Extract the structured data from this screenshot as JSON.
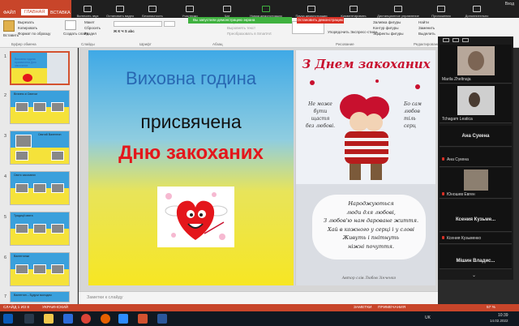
{
  "ribbon": {
    "tabs": [
      "ФАЙЛ",
      "ГЛАВНАЯ",
      "ВСТАВКА"
    ],
    "active_tab": "ГЛАВНАЯ",
    "clipboard": {
      "paste": "Вставить",
      "cut": "Вырезать",
      "copy": "Копировать",
      "format": "Формат по образцу",
      "group": "Буфер обмена"
    },
    "slides": {
      "create": "Создать слайд",
      "layout": "Макет",
      "reset": "Сбросить",
      "section": "Раздел",
      "group": "Слайды"
    },
    "font_group": "Шрифт",
    "paragraph_group": "Абзац",
    "drawing": {
      "arrange": "Упорядочить",
      "quick_styles": "Экспресс-стили",
      "fill": "Заливка фигуры",
      "outline": "Контур фигуры",
      "effects": "Эффекты фигуры",
      "group": "Рисование"
    },
    "editing": {
      "find": "Найти",
      "replace": "Заменить",
      "select": "Выделить",
      "group": "Редактирование"
    },
    "text_direction": "Направление текста",
    "align_text": "Выровнять текст",
    "convert_smartart": "Преобразовать в SmartArt",
    "user": "Вход"
  },
  "zoom": {
    "buttons": [
      "Включить звук",
      "Остановить видео",
      "Безопасность",
      "Участники",
      "Чат",
      "Новая демонстрация",
      "Пауза демонстрации",
      "Комментировать",
      "Дистанционное управление",
      "Приложения",
      "Дополнительно"
    ],
    "participants_count": "52",
    "share_banner": "Вы запустили демонстрацию экрана",
    "stop_share": "Остановить демонстрацию"
  },
  "thumbnails": [
    "1",
    "2",
    "3",
    "4",
    "5",
    "6",
    "7"
  ],
  "thumb_texts": {
    "t1_title": "Виховна година присвячена Дню закоханих",
    "t2_title": "Вітання зі Святом",
    "t3_title": "Святий Валентин",
    "t4_title": "Свято закоханих",
    "t5_title": "Традиції свята",
    "t6_title": "Валентинки",
    "t7_text": "Валентин – Будучи молодим"
  },
  "slide": {
    "title_line1": "Виховна година",
    "title_line2": "присвячена",
    "title_line3": "Дню закоханих",
    "card_title": "З Днем закоханих",
    "verse_left": [
      "Не може",
      "бути",
      "щастя",
      "без любові."
    ],
    "verse_right": [
      "Бо сам",
      "любов",
      "тіль",
      "серц"
    ],
    "verse_bottom": [
      "Народжуються",
      "люди для любові,",
      "З любов'ю нам дароване життя.",
      "Хай в кожного у серці і у слові",
      "Живуть і пнітнуть",
      "ніжні почуття."
    ],
    "author": "Автор слів Любов Зінченко"
  },
  "notes_placeholder": "Заметки к слайду",
  "participants": [
    {
      "name": "Marila Zheltnaja",
      "type": "video"
    },
    {
      "name": "Tchagam Leatica",
      "type": "video"
    },
    {
      "name": "Ана Сукена",
      "type": "name"
    },
    {
      "name": "Ана Сукена",
      "type": "small"
    },
    {
      "name": "Юношев Евген",
      "type": "small"
    },
    {
      "name": "Ксения Кузьме...",
      "type": "name"
    },
    {
      "name": "Ксения Кузьменко",
      "type": "small"
    },
    {
      "name": "Мішин Владис...",
      "type": "name"
    }
  ],
  "status": {
    "slide_info": "СЛАЙД 1 ИЗ 8",
    "language": "УКРАИНСКИЙ",
    "notes": "ЗАМЕТКИ",
    "comments": "ПРИМЕЧАНИЯ",
    "zoom": "57 %"
  },
  "taskbar": {
    "lang": "UK",
    "time": "10:39",
    "date": "14.02.2022"
  },
  "colors": {
    "ppt_accent": "#c8452a",
    "title_blue": "#2867b2",
    "title_red": "#e4161b",
    "zoom_green": "#3fb13f",
    "zoom_red": "#d93025"
  }
}
